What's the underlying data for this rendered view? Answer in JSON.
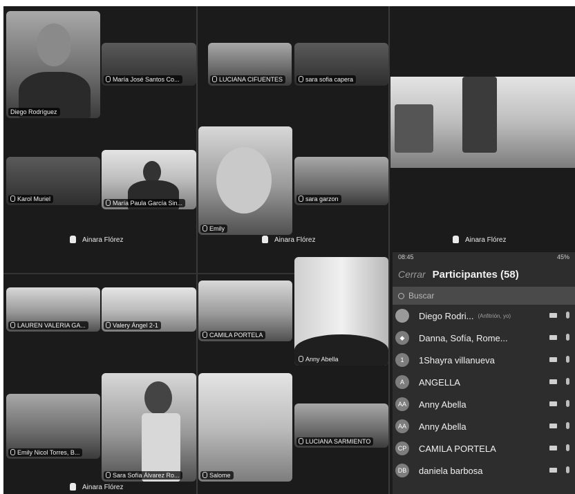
{
  "tiles": {
    "diego": "Diego Rodríguez",
    "maria_jose": "María José Santos Co...",
    "luciana_c": "LUCIANA CIFUENTES",
    "sara_capera": "sara sofia capera",
    "karol": "Karol Muriel",
    "maria_paula": "María Paula García Sin...",
    "emily": "Emily",
    "sara_garzon": "sara garzon",
    "lauren": "LAUREN VALERIA GA...",
    "valery": "Valery Ángel 2-1",
    "camila": "CAMILA PORTELA",
    "anny": "Anny Abella",
    "emily_nicol": "Emily Nicol Torres, B...",
    "sara_alvarez": "Sara Sofía Álvarez Ro...",
    "salome": "Salome",
    "luciana_s": "LUCIANA SARMIENTO"
  },
  "pinned": {
    "p1": "Ainara Flórez",
    "p2": "Ainara Flórez",
    "p3": "Ainara Flórez",
    "p4": "Ainara Flórez"
  },
  "phone": {
    "time": "08:45",
    "battery": "45%",
    "close_label": "Cerrar",
    "title": "Participantes (58)",
    "search_placeholder": "Buscar"
  },
  "participants": [
    {
      "initials": "",
      "name": "Diego Rodri...",
      "role": "(Anfitrión, yo)"
    },
    {
      "initials": "◆",
      "name": "Danna, Sofía, Rome...",
      "role": ""
    },
    {
      "initials": "1",
      "name": "1Shayra villanueva",
      "role": ""
    },
    {
      "initials": "A",
      "name": "ANGELLA",
      "role": ""
    },
    {
      "initials": "AA",
      "name": "Anny Abella",
      "role": ""
    },
    {
      "initials": "AA",
      "name": "Anny Abella",
      "role": ""
    },
    {
      "initials": "CP",
      "name": "CAMILA PORTELA",
      "role": ""
    },
    {
      "initials": "DB",
      "name": "daniela barbosa",
      "role": ""
    }
  ]
}
